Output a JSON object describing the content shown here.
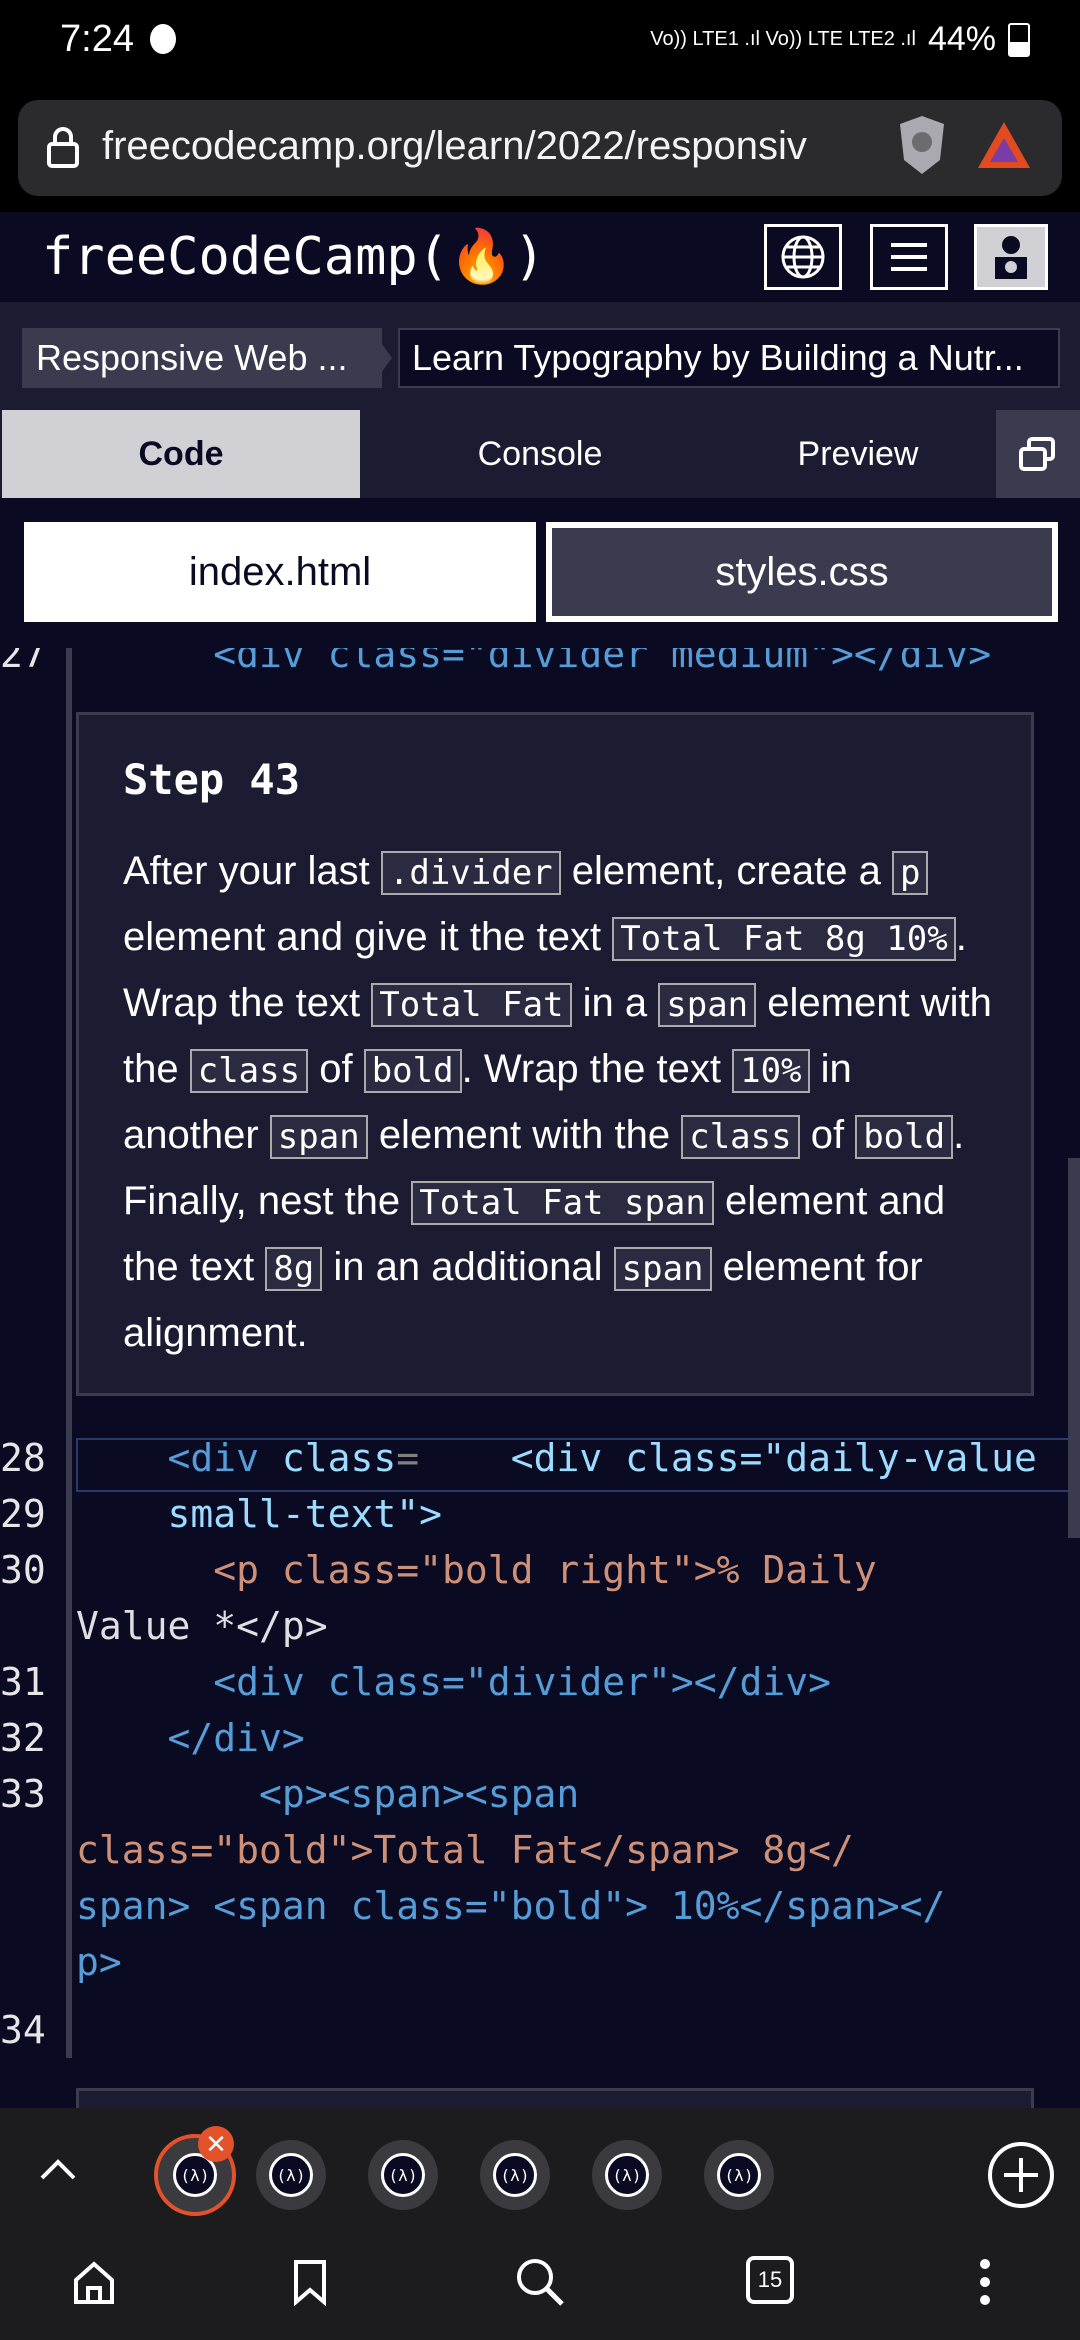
{
  "status_bar": {
    "time": "7:24",
    "network": "Vo)) LTE1 .ıl Vo)) LTE LTE2 .ıl",
    "battery": "44%"
  },
  "browser": {
    "url": "freecodecamp.org/learn/2022/responsiv",
    "tab_count": "15"
  },
  "site": {
    "logo": "freeCodeCamp(🔥)"
  },
  "breadcrumb": {
    "course": "Responsive Web ...",
    "project": "Learn Typography by Building a Nutr..."
  },
  "tabs": [
    "Code",
    "Console",
    "Preview"
  ],
  "file_tabs": [
    "index.html",
    "styles.css"
  ],
  "step": {
    "title": "Step 43",
    "text_1": "After your last",
    "code_1": ".divider",
    "text_2": "element, create a",
    "code_2": "p",
    "text_3": "element and give it the text",
    "code_3": "Total Fat 8g 10%",
    "text_4": ". Wrap the text",
    "code_4": "Total Fat",
    "text_5": "in a",
    "code_5": "span",
    "text_6": "element with the",
    "code_6": "class",
    "text_7": "of",
    "code_7": "bold",
    "text_8": ". Wrap the text",
    "code_8": "10%",
    "text_9": "in another",
    "code_9": "span",
    "text_10": "element with the",
    "code_10": "class",
    "text_11": "of",
    "code_11": "bold",
    "text_12": ". Finally, nest the",
    "code_12": "Total Fat span",
    "text_13": "element and the text",
    "code_13": "8g",
    "text_14": "in an additional",
    "code_14": "span",
    "text_15": "element for alignment."
  },
  "code_lines": {
    "n28": "28",
    "n29": "29",
    "n30": "30",
    "n31": "31",
    "n32": "32",
    "n33": "33",
    "n34": "34",
    "l28": "    <div class=\"daily-value",
    "l29": "    small-text\">",
    "l30a": "      <p class=\"bold right\">% Daily",
    "l30b": "Value *</p>",
    "l31": "      <div class=\"divider\"></div>",
    "l32": "    </div>",
    "l33a": "        <p><span><span",
    "l33b": "class=\"bold\">Total Fat</span> 8g</",
    "l33c": "span> <span class=\"bold\"> 10%</span></",
    "l33d": "p>",
    "top_partial": "      <div class=\"divider medium\"></div>"
  }
}
